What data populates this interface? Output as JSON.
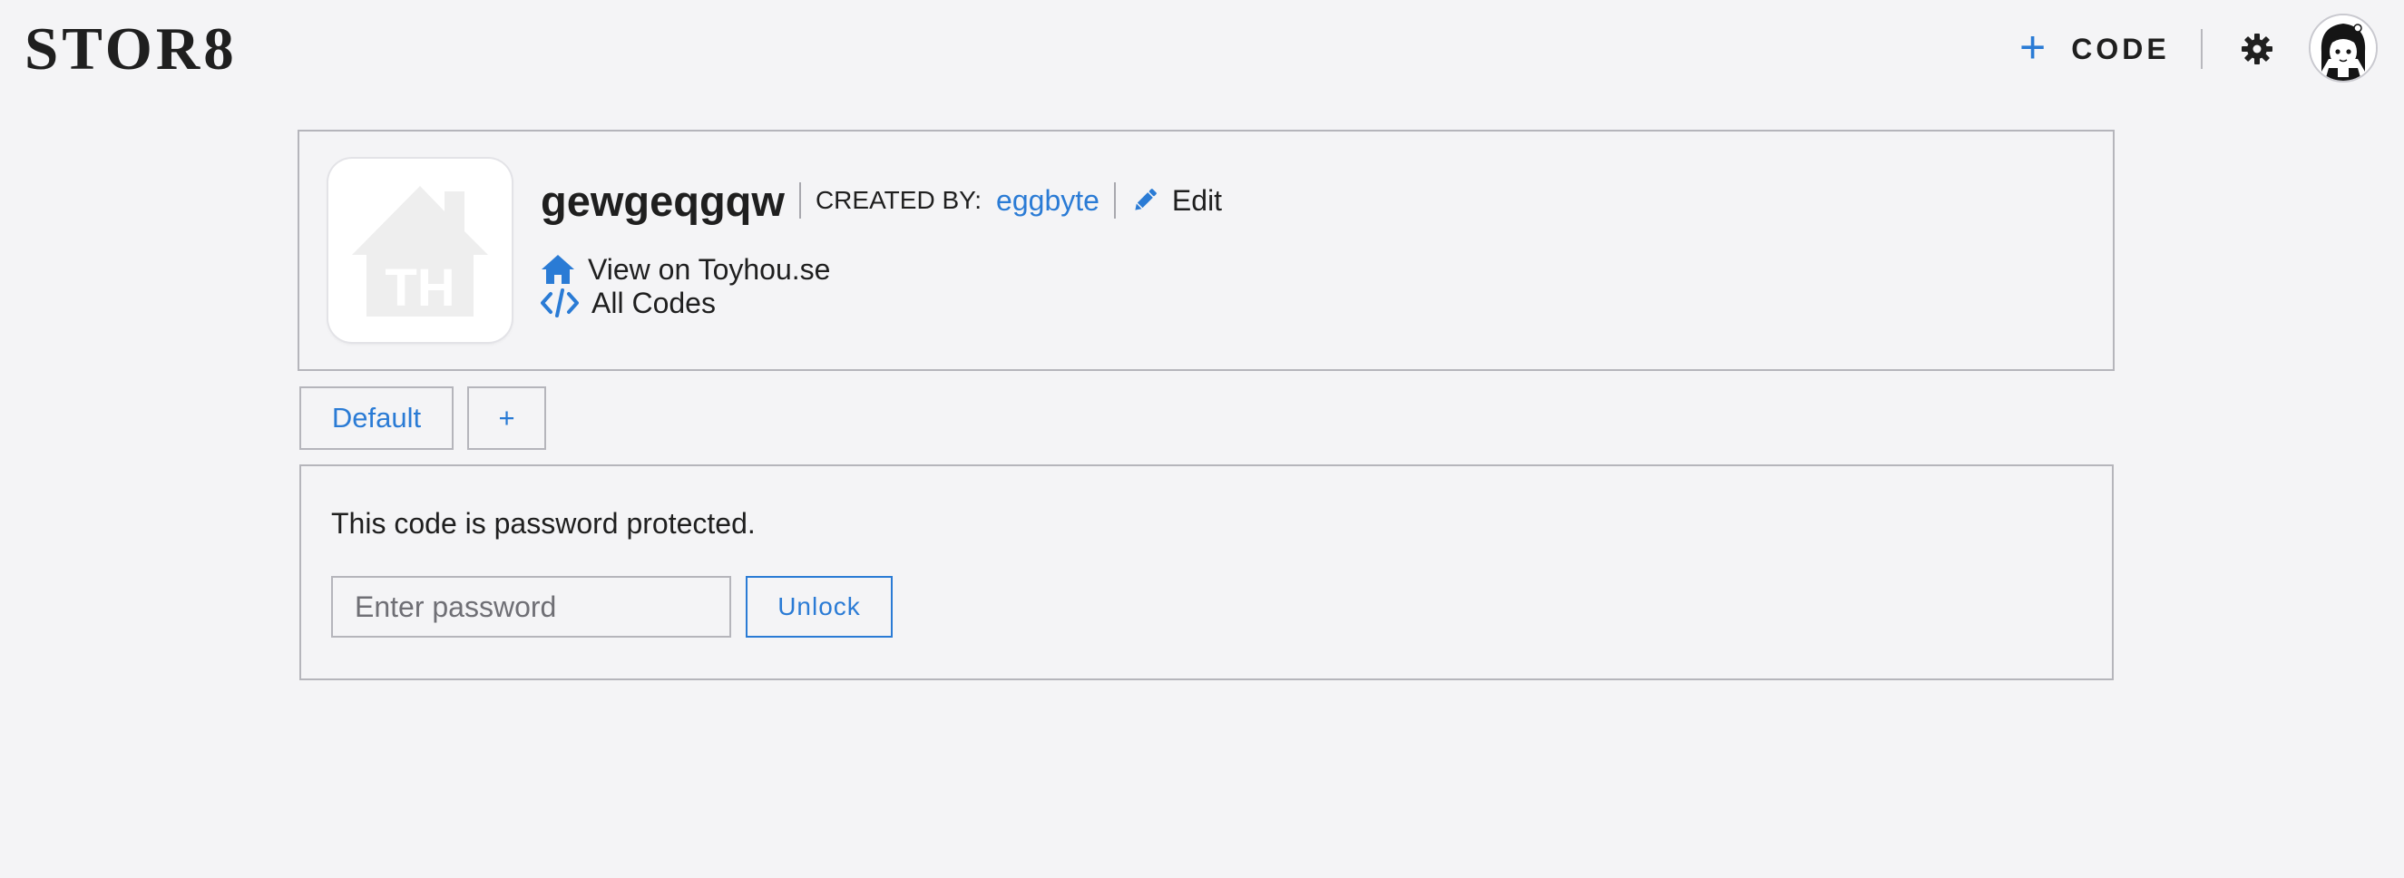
{
  "brand": {
    "logo_text": "STOR8"
  },
  "topnav": {
    "new_code_label": "CODE",
    "new_code_icon": "plus-icon",
    "settings_icon": "gear-icon",
    "avatar_icon": "user-avatar"
  },
  "code": {
    "name": "gewgeqgqw",
    "created_by_label": "CREATED BY:",
    "creator": "eggbyte",
    "edit_label": "Edit",
    "thumbnail_icon": "toyhouse-house-icon",
    "thumbnail_text": "TH",
    "links": [
      {
        "label": "View on Toyhou.se",
        "icon": "home-icon"
      },
      {
        "label": "All Codes",
        "icon": "code-icon"
      }
    ]
  },
  "tabs": [
    {
      "label": "Default"
    },
    {
      "label": "+"
    }
  ],
  "lock": {
    "message": "This code is password protected.",
    "password_placeholder": "Enter password",
    "password_value": "",
    "unlock_label": "Unlock"
  },
  "colors": {
    "accent": "#2a7bd5",
    "background": "#f4f4f6",
    "border": "#b5b5bb",
    "text": "#1f1f1f"
  }
}
